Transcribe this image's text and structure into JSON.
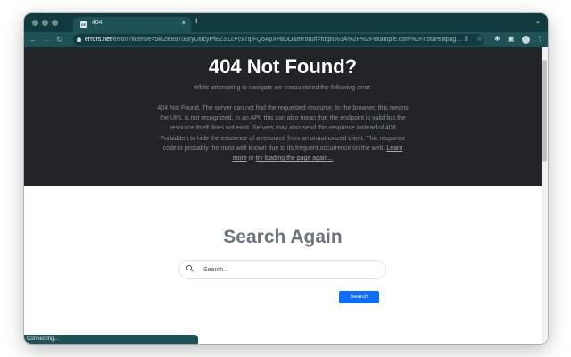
{
  "browser": {
    "tab": {
      "favicon": "DE",
      "title": "404",
      "close": "×"
    },
    "new_tab": "+",
    "tab_menu": "⌄",
    "back": "←",
    "forward": "→",
    "reload": "↻",
    "url_host": "errors.net",
    "url_rest": "/error/?license=5ki2le897uBryUBcyPfEZ31ZPcv7qlFQoApXHa0O&errorurl=https%3A%2F%2Fexample.com%2Fnotarealpag…",
    "icons": [
      "share-icon",
      "star-icon",
      "extensions-icon",
      "sidebar-icon",
      "profile-icon",
      "menu-icon"
    ],
    "share_glyph": "⇪",
    "star_glyph": "☆",
    "puzzle_glyph": "✱",
    "sidebar_glyph": "▣",
    "menu_glyph": "⋮",
    "status": "Connecting..."
  },
  "hero": {
    "title": "404 Not Found?",
    "subtitle": "While attempting to navigate we encountered the following error:",
    "body": "404 Not Found. The server can not find the requested resource. In the browser, this means the URL is not recognized. In an API, this can also mean that the endpoint is valid but the resource itself does not exist. Servers may also send this response instead of 403 Forbidden to hide the existence of a resource from an unauthorized client. This response code is probably the most well known due to its frequent occurrence on the web.",
    "learn_more": "Learn more",
    "or": "or",
    "try_again": "try loading the page again..."
  },
  "search": {
    "title": "Search Again",
    "placeholder": "Search...",
    "button": "Search"
  },
  "colors": {
    "frame": "#123b3f",
    "toolbar": "#1f5257",
    "hero_bg": "#212529",
    "accent": "#0d6efd"
  }
}
